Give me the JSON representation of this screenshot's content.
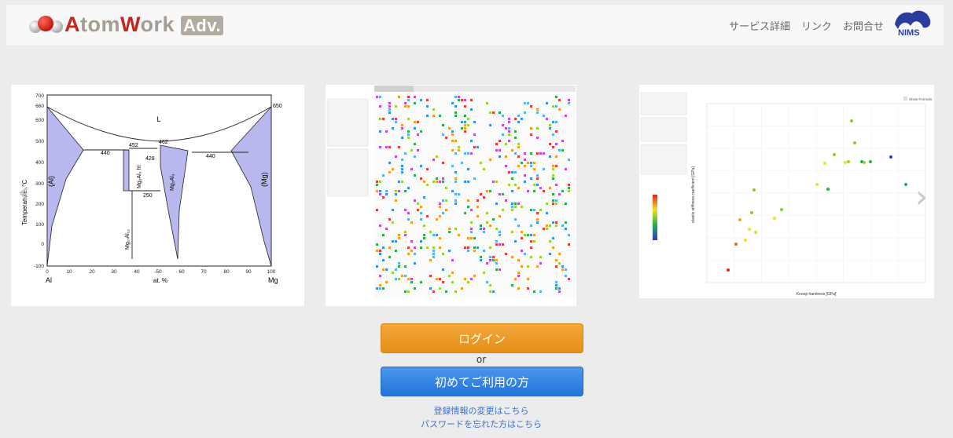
{
  "header": {
    "logo_text": "AtomWork",
    "logo_suffix": "Adv.",
    "nav": [
      "サービス詳細",
      "リンク",
      "お問合せ"
    ],
    "org_logo": "NIMS"
  },
  "carousel": {
    "prev_icon": "chevron-left-icon",
    "next_icon": "chevron-right-icon",
    "phase_diagram": {
      "phase_L": "L",
      "phase_Al": "(Al)",
      "phase_Mg": "(Mg)",
      "t_650": "650",
      "t_660": "660",
      "t_452": "452",
      "t_462": "462",
      "t_440a": "440",
      "t_440b": "440",
      "t_428": "428",
      "t_250": "250",
      "ht_label": "Mg₂Al₃ ht",
      "mgal_label": "Mg₂Al₃",
      "mg17_label": "Mg₁₇Al₁₂",
      "ylabel": "Temperature, °C",
      "xlabel": "at. %",
      "left_el": "Al",
      "right_el": "Mg",
      "yticks": [
        "700",
        "660",
        "600",
        "500",
        "400",
        "300",
        "200",
        "100",
        "0",
        "-100"
      ],
      "xticks": [
        "0",
        "10",
        "20",
        "30",
        "40",
        "50",
        "60",
        "70",
        "80",
        "90",
        "100"
      ]
    },
    "property_chart": {
      "legend_title": "Show Formula",
      "xlabel": "Knoop hardness [GPa]",
      "ylabel": "elastic stiffness coefficient [GPa]"
    }
  },
  "auth": {
    "login_label": "ログイン",
    "or_label": "or",
    "first_time_label": "初めてご利用の方",
    "change_info_link": "登録情報の変更はこちら",
    "forgot_password_link": "パスワードを忘れた方はこちら"
  },
  "colors": {
    "login": "#e8951f",
    "first_time": "#2c7fe0",
    "link": "#3b6fd0",
    "phase_fill": "#b8b8ee"
  }
}
